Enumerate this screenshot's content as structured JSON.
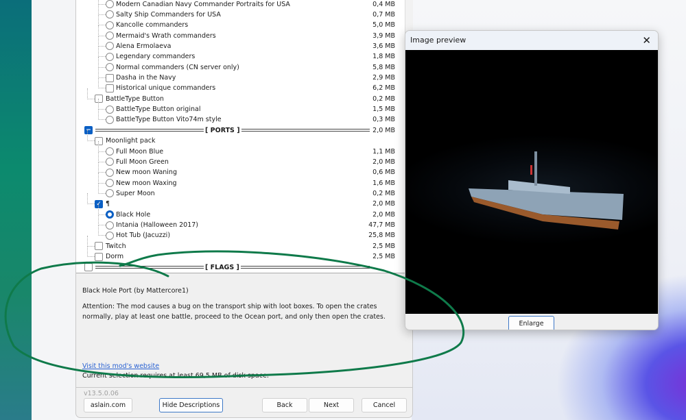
{
  "tree": {
    "rows": [
      {
        "label": "Modern Canadian Navy Commander Portraits for USA",
        "size": "0,4 MB",
        "type": "radio",
        "level": 2,
        "checked": false
      },
      {
        "label": "Salty Ship Commanders for USA",
        "size": "0,7 MB",
        "type": "radio",
        "level": 2,
        "checked": false
      },
      {
        "label": "Kancolle commanders",
        "size": "5,0 MB",
        "type": "radio",
        "level": 2,
        "checked": false
      },
      {
        "label": "Mermaid's Wrath commanders",
        "size": "3,9 MB",
        "type": "radio",
        "level": 2,
        "checked": false
      },
      {
        "label": "Alena Ermolaeva",
        "size": "3,6 MB",
        "type": "radio",
        "level": 2,
        "checked": false
      },
      {
        "label": "Legendary commanders",
        "size": "1,8 MB",
        "type": "radio",
        "level": 2,
        "checked": false
      },
      {
        "label": "Normal commanders (CN server only)",
        "size": "5,8 MB",
        "type": "radio",
        "level": 2,
        "checked": false
      },
      {
        "label": "Dasha in the Navy",
        "size": "2,9 MB",
        "type": "checkbox",
        "level": 2,
        "checked": false
      },
      {
        "label": "Historical unique commanders",
        "size": "6,2 MB",
        "type": "checkbox",
        "level": 2,
        "checked": false
      },
      {
        "label": "BattleType Button",
        "size": "0,2 MB",
        "type": "checkbox",
        "level": 1,
        "checked": false
      },
      {
        "label": "BattleType Button original",
        "size": "1,5 MB",
        "type": "radio",
        "level": 2,
        "checked": false
      },
      {
        "label": "BattleType Button Vito74m style",
        "size": "0,3 MB",
        "type": "radio",
        "level": 2,
        "checked": false
      },
      {
        "label": "PORTS",
        "size": "2,0 MB",
        "type": "section",
        "level": 0,
        "checked": true
      },
      {
        "label": "Moonlight pack",
        "size": "",
        "type": "checkbox",
        "level": 1,
        "checked": false
      },
      {
        "label": "Full Moon Blue",
        "size": "1,1 MB",
        "type": "radio",
        "level": 2,
        "checked": false
      },
      {
        "label": "Full Moon Green",
        "size": "2,0 MB",
        "type": "radio",
        "level": 2,
        "checked": false
      },
      {
        "label": "New moon Waning",
        "size": "0,6 MB",
        "type": "radio",
        "level": 2,
        "checked": false
      },
      {
        "label": "New moon Waxing",
        "size": "1,6 MB",
        "type": "radio",
        "level": 2,
        "checked": false
      },
      {
        "label": "Super Moon",
        "size": "0,2 MB",
        "type": "radio",
        "level": 2,
        "checked": false
      },
      {
        "label": "¶",
        "size": "2,0 MB",
        "type": "checkbox",
        "level": 1,
        "checked": true
      },
      {
        "label": "Black Hole",
        "size": "2,0 MB",
        "type": "radio",
        "level": 2,
        "checked": true
      },
      {
        "label": "Intania (Halloween 2017)",
        "size": "47,7 MB",
        "type": "radio",
        "level": 2,
        "checked": false
      },
      {
        "label": "Hot Tub (Jacuzzi)",
        "size": "25,8 MB",
        "type": "radio",
        "level": 2,
        "checked": false
      },
      {
        "label": "Twitch",
        "size": "2,5 MB",
        "type": "checkbox",
        "level": 1,
        "checked": false
      },
      {
        "label": "Dorm",
        "size": "2,5 MB",
        "type": "checkbox",
        "level": 1,
        "checked": false
      },
      {
        "label": "FLAGS",
        "size": "",
        "type": "section",
        "level": 0,
        "checked": false
      }
    ]
  },
  "description": {
    "title": "Black Hole Port (by Mattercore1)",
    "body": "Attention: The mod causes a bug on the transport ship with loot boxes. To open the crates normally, play at least one battle, proceed to the Ocean port, and only then open the crates.",
    "link": "Visit this mod's website",
    "requirement": "Current selection requires at least 69,5 MB of disk space."
  },
  "footer": {
    "version": "v13.5.0.06",
    "site_button": "aslain.com",
    "hide_descriptions": "Hide Descriptions",
    "back": "Back",
    "next": "Next",
    "cancel": "Cancel"
  },
  "preview": {
    "title": "Image preview",
    "close_icon": "close-icon",
    "enlarge": "Enlarge"
  },
  "colors": {
    "accent": "#0a5fc4",
    "annotation": "#0f7a4a",
    "link": "#2a62d2"
  }
}
